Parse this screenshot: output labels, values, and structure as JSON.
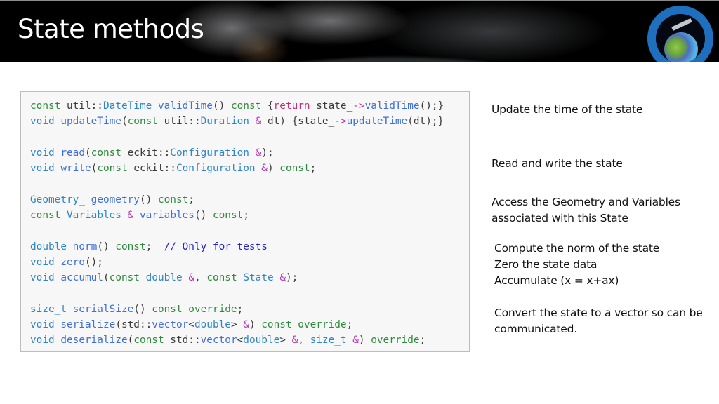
{
  "slide": {
    "title": "State methods",
    "logo_icon": "jcsda-logo-icon"
  },
  "code": {
    "lines": [
      [
        {
          "t": "kw",
          "s": "const"
        },
        {
          "t": "",
          "s": " util::"
        },
        {
          "t": "ty",
          "s": "DateTime"
        },
        {
          "t": "",
          "s": " "
        },
        {
          "t": "fn",
          "s": "validTime"
        },
        {
          "t": "",
          "s": "() "
        },
        {
          "t": "kw",
          "s": "const"
        },
        {
          "t": "",
          "s": " {"
        },
        {
          "t": "rt",
          "s": "return"
        },
        {
          "t": "",
          "s": " state_"
        },
        {
          "t": "op",
          "s": "->"
        },
        {
          "t": "fn",
          "s": "validTime"
        },
        {
          "t": "",
          "s": "();}"
        }
      ],
      [
        {
          "t": "ty",
          "s": "void"
        },
        {
          "t": "",
          "s": " "
        },
        {
          "t": "fn",
          "s": "updateTime"
        },
        {
          "t": "",
          "s": "("
        },
        {
          "t": "kw",
          "s": "const"
        },
        {
          "t": "",
          "s": " util::"
        },
        {
          "t": "ty",
          "s": "Duration"
        },
        {
          "t": "",
          "s": " "
        },
        {
          "t": "op",
          "s": "&"
        },
        {
          "t": "",
          "s": " dt) {state_"
        },
        {
          "t": "op",
          "s": "->"
        },
        {
          "t": "fn",
          "s": "updateTime"
        },
        {
          "t": "",
          "s": "(dt);}"
        }
      ],
      [],
      [
        {
          "t": "ty",
          "s": "void"
        },
        {
          "t": "",
          "s": " "
        },
        {
          "t": "fn",
          "s": "read"
        },
        {
          "t": "",
          "s": "("
        },
        {
          "t": "kw",
          "s": "const"
        },
        {
          "t": "",
          "s": " eckit::"
        },
        {
          "t": "ty",
          "s": "Configuration"
        },
        {
          "t": "",
          "s": " "
        },
        {
          "t": "op",
          "s": "&"
        },
        {
          "t": "",
          "s": ");"
        }
      ],
      [
        {
          "t": "ty",
          "s": "void"
        },
        {
          "t": "",
          "s": " "
        },
        {
          "t": "fn",
          "s": "write"
        },
        {
          "t": "",
          "s": "("
        },
        {
          "t": "kw",
          "s": "const"
        },
        {
          "t": "",
          "s": " eckit::"
        },
        {
          "t": "ty",
          "s": "Configuration"
        },
        {
          "t": "",
          "s": " "
        },
        {
          "t": "op",
          "s": "&"
        },
        {
          "t": "",
          "s": ") "
        },
        {
          "t": "kw",
          "s": "const"
        },
        {
          "t": "",
          "s": ";"
        }
      ],
      [],
      [
        {
          "t": "ty",
          "s": "Geometry_"
        },
        {
          "t": "",
          "s": " "
        },
        {
          "t": "fn",
          "s": "geometry"
        },
        {
          "t": "",
          "s": "() "
        },
        {
          "t": "kw",
          "s": "const"
        },
        {
          "t": "",
          "s": ";"
        }
      ],
      [
        {
          "t": "kw",
          "s": "const"
        },
        {
          "t": "",
          "s": " "
        },
        {
          "t": "ty",
          "s": "Variables"
        },
        {
          "t": "",
          "s": " "
        },
        {
          "t": "op",
          "s": "&"
        },
        {
          "t": "",
          "s": " "
        },
        {
          "t": "fn",
          "s": "variables"
        },
        {
          "t": "",
          "s": "() "
        },
        {
          "t": "kw",
          "s": "const"
        },
        {
          "t": "",
          "s": ";"
        }
      ],
      [],
      [
        {
          "t": "ty",
          "s": "double"
        },
        {
          "t": "",
          "s": " "
        },
        {
          "t": "fn",
          "s": "norm"
        },
        {
          "t": "",
          "s": "() "
        },
        {
          "t": "kw",
          "s": "const"
        },
        {
          "t": "",
          "s": ";  "
        },
        {
          "t": "cm",
          "s": "// Only for tests"
        }
      ],
      [
        {
          "t": "ty",
          "s": "void"
        },
        {
          "t": "",
          "s": " "
        },
        {
          "t": "fn",
          "s": "zero"
        },
        {
          "t": "",
          "s": "();"
        }
      ],
      [
        {
          "t": "ty",
          "s": "void"
        },
        {
          "t": "",
          "s": " "
        },
        {
          "t": "fn",
          "s": "accumul"
        },
        {
          "t": "",
          "s": "("
        },
        {
          "t": "kw",
          "s": "const"
        },
        {
          "t": "",
          "s": " "
        },
        {
          "t": "ty",
          "s": "double"
        },
        {
          "t": "",
          "s": " "
        },
        {
          "t": "op",
          "s": "&"
        },
        {
          "t": "",
          "s": ", "
        },
        {
          "t": "kw",
          "s": "const"
        },
        {
          "t": "",
          "s": " "
        },
        {
          "t": "ty",
          "s": "State"
        },
        {
          "t": "",
          "s": " "
        },
        {
          "t": "op",
          "s": "&"
        },
        {
          "t": "",
          "s": ");"
        }
      ],
      [],
      [
        {
          "t": "ty",
          "s": "size_t"
        },
        {
          "t": "",
          "s": " "
        },
        {
          "t": "fn",
          "s": "serialSize"
        },
        {
          "t": "",
          "s": "() "
        },
        {
          "t": "kw",
          "s": "const override"
        },
        {
          "t": "",
          "s": ";"
        }
      ],
      [
        {
          "t": "ty",
          "s": "void"
        },
        {
          "t": "",
          "s": " "
        },
        {
          "t": "fn",
          "s": "serialize"
        },
        {
          "t": "",
          "s": "(std::"
        },
        {
          "t": "fn",
          "s": "vector"
        },
        {
          "t": "",
          "s": "<"
        },
        {
          "t": "ty",
          "s": "double"
        },
        {
          "t": "",
          "s": "> "
        },
        {
          "t": "op",
          "s": "&"
        },
        {
          "t": "",
          "s": ") "
        },
        {
          "t": "kw",
          "s": "const override"
        },
        {
          "t": "",
          "s": ";"
        }
      ],
      [
        {
          "t": "ty",
          "s": "void"
        },
        {
          "t": "",
          "s": " "
        },
        {
          "t": "fn",
          "s": "deserialize"
        },
        {
          "t": "",
          "s": "("
        },
        {
          "t": "kw",
          "s": "const"
        },
        {
          "t": "",
          "s": " std::"
        },
        {
          "t": "fn",
          "s": "vector"
        },
        {
          "t": "",
          "s": "<"
        },
        {
          "t": "ty",
          "s": "double"
        },
        {
          "t": "",
          "s": "> "
        },
        {
          "t": "op",
          "s": "&"
        },
        {
          "t": "",
          "s": ", "
        },
        {
          "t": "ty",
          "s": "size_t"
        },
        {
          "t": "",
          "s": " "
        },
        {
          "t": "op",
          "s": "&"
        },
        {
          "t": "",
          "s": ") "
        },
        {
          "t": "kw",
          "s": "override"
        },
        {
          "t": "",
          "s": ";"
        }
      ]
    ]
  },
  "notes": {
    "update_time": "Update the time of the state",
    "read_write": "Read and write the state",
    "access_1": "Access the Geometry and Variables",
    "access_2": "associated with this State",
    "norm": "Compute the norm of the state",
    "zero": "Zero the state data",
    "accumulate": "Accumulate (x = x+ax)",
    "convert_1": "Convert the state to a vector so can be",
    "convert_2": "communicated."
  }
}
